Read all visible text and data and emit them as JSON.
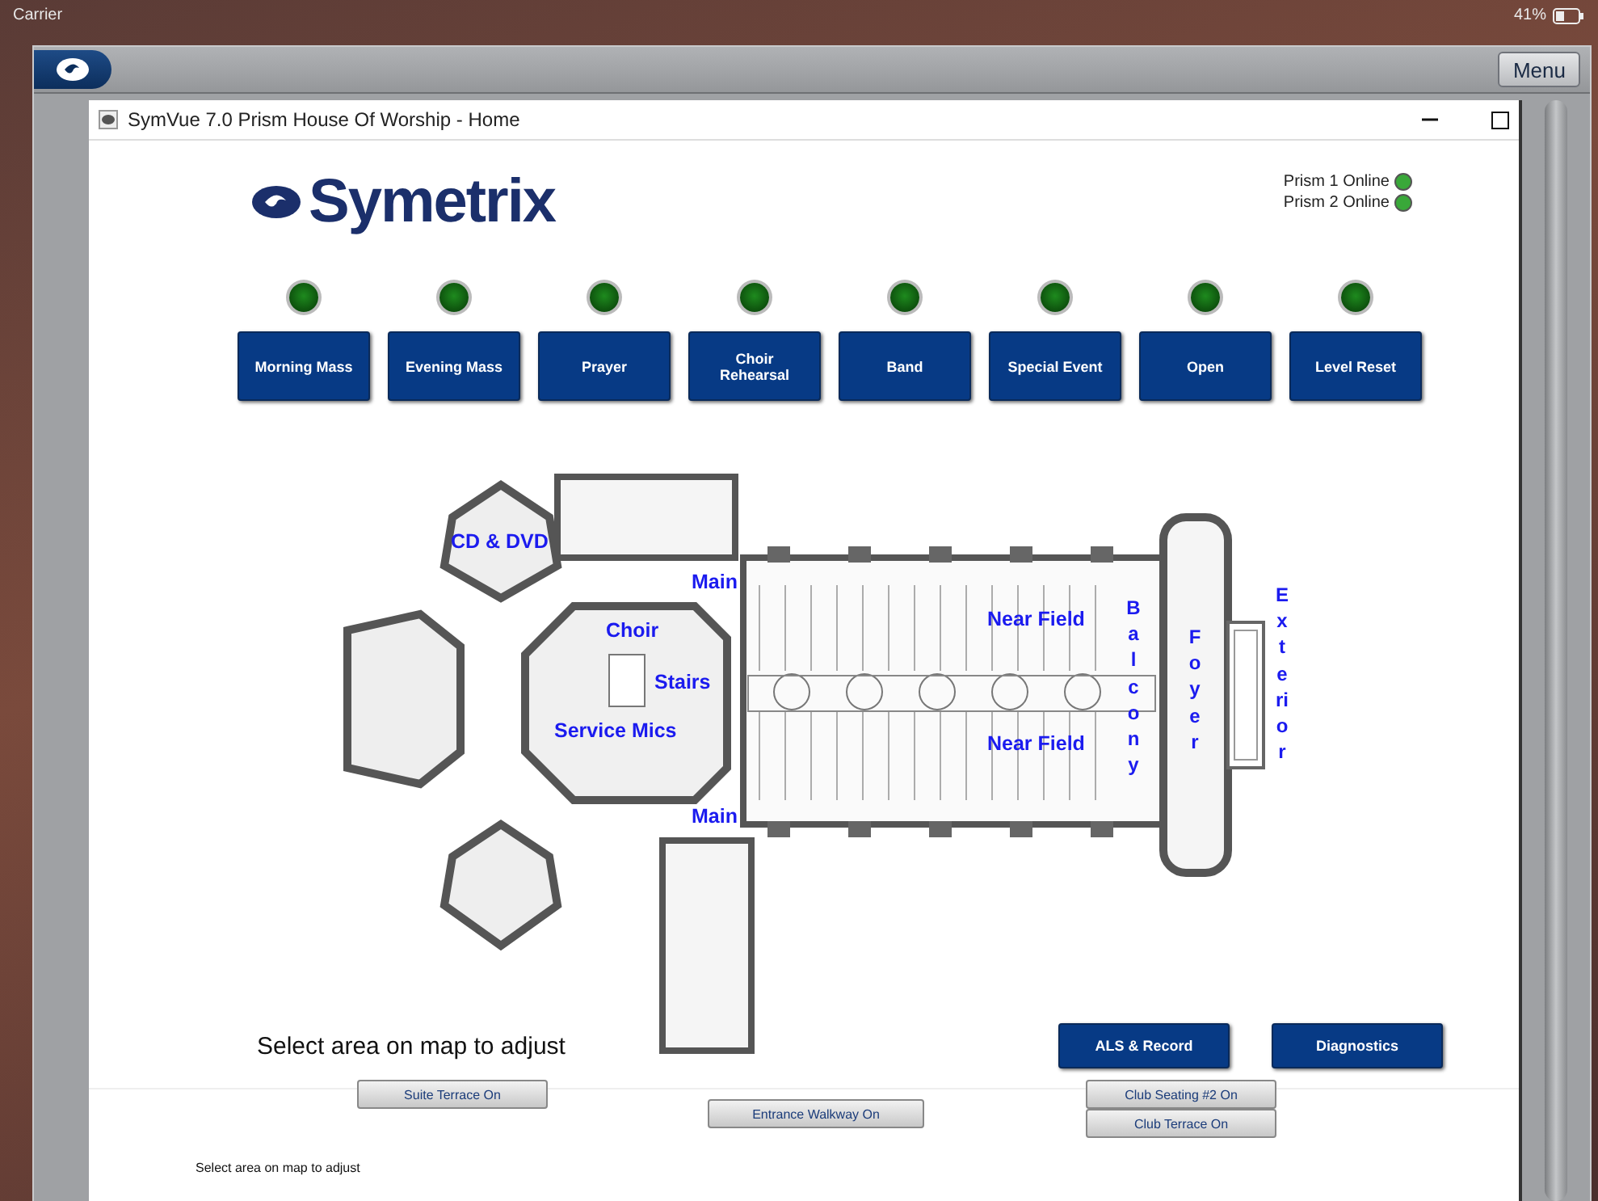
{
  "status_bar": {
    "carrier": "Carrier",
    "battery": "41%"
  },
  "toolbar": {
    "menu_button": "Menu"
  },
  "window": {
    "title": "SymVue 7.0 Prism House Of Worship - Home"
  },
  "logo": {
    "text": "Symetrix"
  },
  "devices": [
    {
      "label": "Prism 1 Online",
      "online": true
    },
    {
      "label": "Prism 2 Online",
      "online": true
    }
  ],
  "presets": [
    {
      "label": "Morning Mass",
      "lit": false
    },
    {
      "label": "Evening Mass",
      "lit": false
    },
    {
      "label": "Prayer",
      "lit": false
    },
    {
      "label": "Choir Rehearsal",
      "lit": false
    },
    {
      "label": "Band",
      "lit": false
    },
    {
      "label": "Special Event",
      "lit": false
    },
    {
      "label": "Open",
      "lit": false
    },
    {
      "label": "Level Reset",
      "lit": false
    }
  ],
  "map_labels": [
    {
      "text": "CD & DVD",
      "kind": "horizontal"
    },
    {
      "text": "Main",
      "kind": "horizontal"
    },
    {
      "text": "Choir",
      "kind": "horizontal"
    },
    {
      "text": "Stairs",
      "kind": "horizontal"
    },
    {
      "text": "Service Mics",
      "kind": "horizontal"
    },
    {
      "text": "Main",
      "kind": "horizontal"
    },
    {
      "text": "Near Field",
      "kind": "horizontal"
    },
    {
      "text": "Near Field",
      "kind": "horizontal"
    },
    {
      "text": "Balcony",
      "kind": "vertical"
    },
    {
      "text": "Foyer",
      "kind": "vertical"
    },
    {
      "text": "Exterior",
      "kind": "vertical"
    }
  ],
  "footer": {
    "hint": "Select area on map to adjust",
    "buttons": [
      "ALS & Record",
      "Diagnostics"
    ]
  },
  "background_page": {
    "buttons": [
      "Suite Terrace On",
      "Entrance Walkway On",
      "Club Seating #2 On",
      "Club Terrace On"
    ],
    "hint": "Select area on map to adjust"
  }
}
